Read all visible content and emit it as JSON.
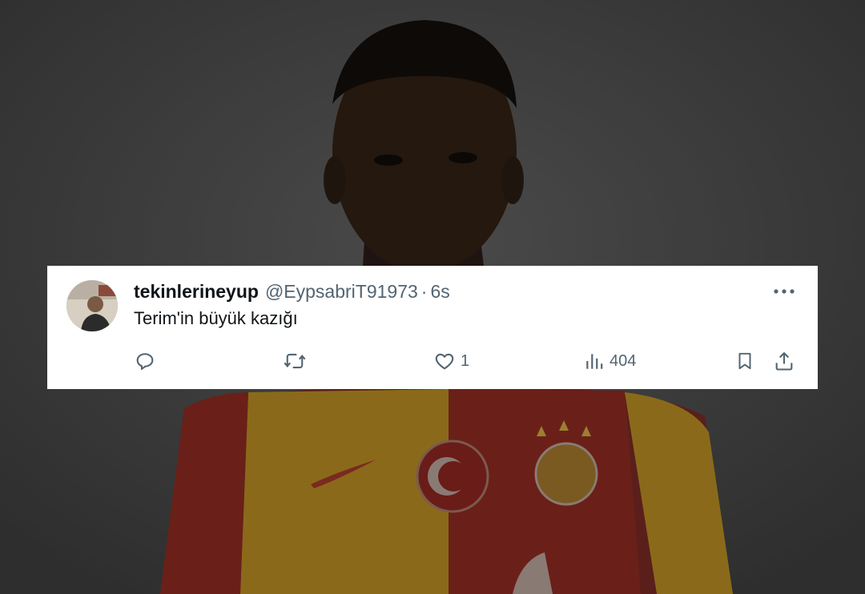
{
  "tweet": {
    "display_name": "tekinlerineyup",
    "handle": "@EypsabriT91973",
    "separator": "·",
    "time": "6s",
    "text": "Terim'in büyük kazığı",
    "actions": {
      "reply_count": "",
      "retweet_count": "",
      "like_count": "1",
      "views_count": "404"
    }
  },
  "icons": {
    "reply": "reply-icon",
    "retweet": "retweet-icon",
    "like": "heart-icon",
    "views": "views-icon",
    "bookmark": "bookmark-icon",
    "share": "share-icon",
    "more": "more-icon"
  },
  "colors": {
    "background_overlay": "#3c3c3c",
    "card": "#ffffff",
    "text_primary": "#0f1419",
    "text_secondary": "#536471",
    "jersey_red": "#c8102e",
    "jersey_yellow": "#f2a900"
  }
}
